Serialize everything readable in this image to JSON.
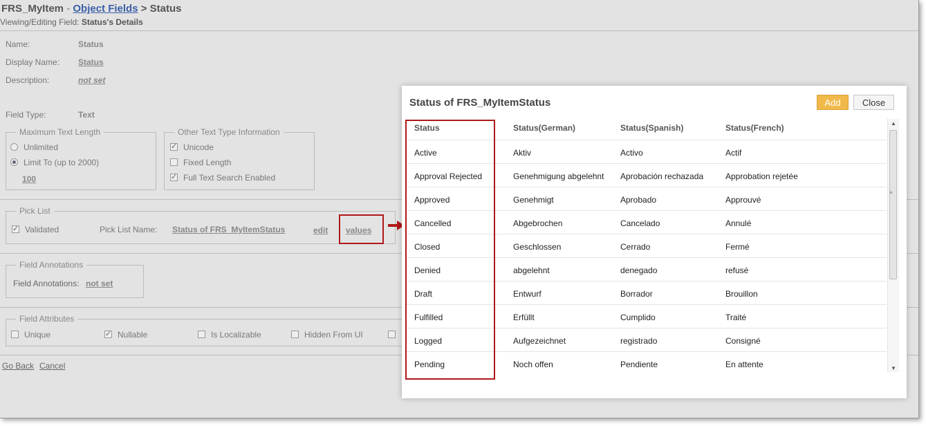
{
  "header": {
    "item": "FRS_MyItem",
    "dash": "-",
    "breadcrumb_link": "Object Fields",
    "breadcrumb_rest": "> Status",
    "subtitle_prefix": "Viewing/Editing Field:",
    "subtitle_value": "Status's Details"
  },
  "details": {
    "name_label": "Name:",
    "name_value": "Status",
    "display_name_label": "Display Name:",
    "display_name_value": "Status",
    "description_label": "Description:",
    "description_value": "not set",
    "field_type_label": "Field Type:",
    "field_type_value": "Text"
  },
  "max_text_length": {
    "legend": "Maximum Text Length",
    "unlimited": "Unlimited",
    "limit_to": "Limit To (up to 2000)",
    "limit_value": "100",
    "selected": "limit_to"
  },
  "other_text": {
    "legend": "Other Text Type Information",
    "unicode": "Unicode",
    "unicode_checked": true,
    "fixed_length": "Fixed Length",
    "fixed_length_checked": false,
    "full_text": "Full Text Search Enabled",
    "full_text_checked": true
  },
  "pick_list": {
    "legend": "Pick List",
    "validated": "Validated",
    "validated_checked": true,
    "name_label": "Pick List Name:",
    "name_value": "Status of FRS_MyItemStatus",
    "edit": "edit",
    "values": "values"
  },
  "annotations": {
    "legend": "Field Annotations",
    "label": "Field Annotations:",
    "value": "not set"
  },
  "attributes": {
    "legend": "Field Attributes",
    "unique": "Unique",
    "unique_checked": false,
    "nullable": "Nullable",
    "nullable_checked": true,
    "localizable": "Is Localizable",
    "localizable_checked": false,
    "hidden": "Hidden From UI",
    "hidden_checked": false
  },
  "footer": {
    "go_back": "Go Back",
    "cancel": "Cancel"
  },
  "modal": {
    "title": "Status of FRS_MyItemStatus",
    "add_label": "Add",
    "close_label": "Close",
    "columns": [
      "Status",
      "Status(German)",
      "Status(Spanish)",
      "Status(French)"
    ],
    "rows": [
      [
        "Active",
        "Aktiv",
        "Activo",
        "Actif"
      ],
      [
        "Approval Rejected",
        "Genehmigung abgelehnt",
        "Aprobación rechazada",
        "Approbation rejetée"
      ],
      [
        "Approved",
        "Genehmigt",
        "Aprobado",
        "Approuvé"
      ],
      [
        "Cancelled",
        "Abgebrochen",
        "Cancelado",
        "Annulé"
      ],
      [
        "Closed",
        "Geschlossen",
        "Cerrado",
        "Fermé"
      ],
      [
        "Denied",
        "abgelehnt",
        "denegado",
        "refusé"
      ],
      [
        "Draft",
        "Entwurf",
        "Borrador",
        "Brouillon"
      ],
      [
        "Fulfilled",
        "Erfüllt",
        "Cumplido",
        "Traité"
      ],
      [
        "Logged",
        "Aufgezeichnet",
        "registrado",
        "Consigné"
      ],
      [
        "Pending",
        "Noch offen",
        "Pendiente",
        "En attente"
      ]
    ]
  },
  "colors": {
    "accent_button": "#f0b94a",
    "highlight_box": "#b01818",
    "link": "#3a5fa8"
  }
}
